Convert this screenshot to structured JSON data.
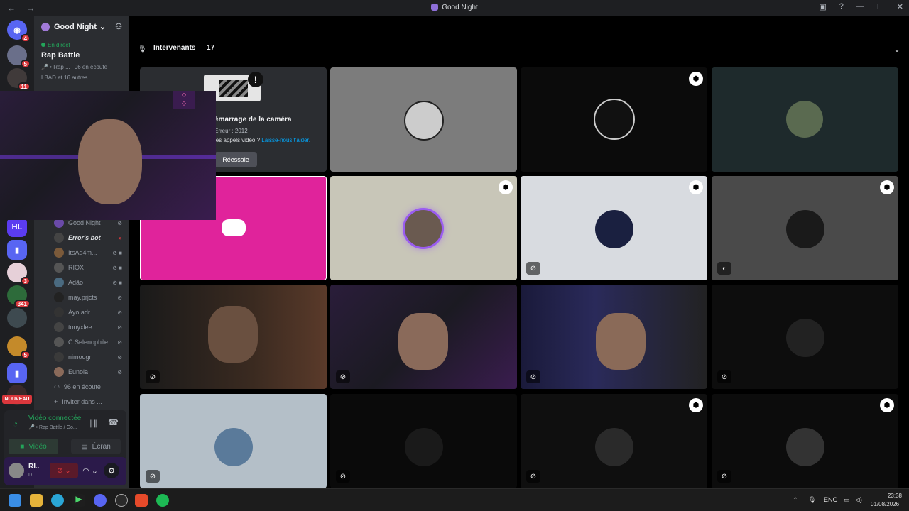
{
  "window": {
    "title": "Good Night"
  },
  "guilds": {
    "badges": [
      "4",
      "5",
      "11",
      "3",
      "341",
      "5"
    ],
    "new_label": "NOUVEAU"
  },
  "server": {
    "name": "Good Night",
    "live_label": "En direct",
    "live_channel": "Rap Battle",
    "live_sub": "🎤 • Rap ...",
    "listeners": "96 en écoute",
    "participants": "LBAD et 16 autres"
  },
  "members": [
    {
      "name": "Good Night"
    },
    {
      "name": "Error's bot"
    },
    {
      "name": "ItsAd4m..."
    },
    {
      "name": "RIOX"
    },
    {
      "name": "Adão"
    },
    {
      "name": "may.prjcts"
    },
    {
      "name": "Ayo adr"
    },
    {
      "name": "tonyxlee"
    },
    {
      "name": "C Selenophile"
    },
    {
      "name": "nimoogn"
    },
    {
      "name": "Eunoia"
    }
  ],
  "channel_footer": {
    "listening": "96 en écoute",
    "invite": "Inviter dans ..."
  },
  "voice": {
    "status": "Vidéo connectée",
    "channel": "🎤 • Rap Battle / Go...",
    "video_label": "Vidéo",
    "screen_label": "Écran"
  },
  "user": {
    "name": "RI..",
    "tag": "D.."
  },
  "stage": {
    "header": "Intervenants — 17"
  },
  "camera_error": {
    "title": "émarrage de la caméra",
    "code": "Erreur : 2012",
    "help_prefix": "les appels vidéo ?",
    "help_link": "Laisse-nous t'aider.",
    "retry": "Réessaie"
  },
  "taskbar": {
    "lang": "ENG",
    "time": "23:38",
    "date": "01/08/2026"
  },
  "colors": {
    "accent": "#5865f2",
    "live": "#23a55a",
    "pink_tile": "#e0239b",
    "danger": "#da373c"
  }
}
